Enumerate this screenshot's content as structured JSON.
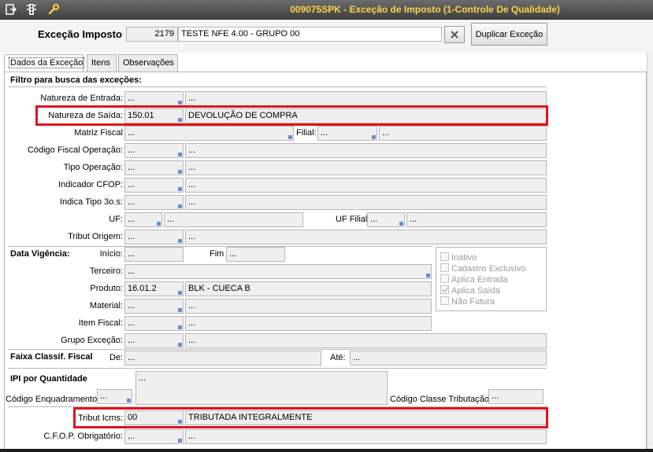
{
  "window": {
    "title": "009075SPK - Exceção de Imposto (1-Controle De Qualidade)"
  },
  "toolbar": {
    "icons": [
      "exit-icon",
      "traffic-light-icon",
      "wrench-icon"
    ]
  },
  "header": {
    "label": "Exceção Imposto",
    "code": "2179",
    "description": "TESTE NFE 4.00 - GRUPO 00",
    "duplicate_button": "Duplicar Exceção"
  },
  "tabs": [
    {
      "label": "Dados da Exceção"
    },
    {
      "label": "Itens"
    },
    {
      "label": "Observações"
    }
  ],
  "form": {
    "section_filter": "Filtro para busca das exceções:",
    "natureza_entrada": {
      "label": "Natureza de Entrada:",
      "code": "...",
      "desc": "..."
    },
    "natureza_saida": {
      "label": "Natureza de Saída:",
      "code": "150.01",
      "desc": "DEVOLUÇÃO DE COMPRA"
    },
    "matriz_fiscal": {
      "label": "Matriz Fiscal",
      "code": "...",
      "filial_label": "Filial:",
      "filial_code": "...",
      "filial_desc": "..."
    },
    "codigo_fiscal": {
      "label": "Código Fiscal Operação:",
      "code": "...",
      "desc": "..."
    },
    "tipo_operacao": {
      "label": "Tipo Operação:",
      "code": "...",
      "desc": "..."
    },
    "indicador_cfop": {
      "label": "Indicador CFOP:",
      "code": "...",
      "desc": "..."
    },
    "indica_tipo": {
      "label": "Indica Tipo 3o.s:",
      "code": "...",
      "desc": "..."
    },
    "uf": {
      "label": "UF:",
      "code": "...",
      "desc": "...",
      "filial_label": "UF Filial",
      "filial_code": "...",
      "filial_desc": "..."
    },
    "tribut_origem": {
      "label": "Tribut Origem:",
      "code": "...",
      "desc": "..."
    },
    "data_vigencia": {
      "label": "Data Vigência:",
      "inicio_label": "Início:",
      "inicio": "...",
      "fim_label": "Fim",
      "fim": "..."
    },
    "terceiro": {
      "label": "Terceiro:",
      "value": "..."
    },
    "produto": {
      "label": "Produto:",
      "code": "16.01.2",
      "desc": "BLK - CUECA B"
    },
    "material": {
      "label": "Material:",
      "code": "...",
      "desc": "..."
    },
    "item_fiscal": {
      "label": "Item Fiscal:",
      "code": "...",
      "desc": "..."
    },
    "grupo_excecao": {
      "label": "Grupo Exceção:",
      "code": "...",
      "desc": "..."
    },
    "faixa": {
      "label": "Faixa Classif. Fiscal",
      "de_label": "De:",
      "de": "...",
      "ate_label": "Até:",
      "ate": "..."
    },
    "ipi": {
      "label": "IPI por Quantidade",
      "memo": "...",
      "enquadramento_label": "Código Enquadramento",
      "enquadramento": "...",
      "classe_label": "Código Classe Tributação",
      "classe": "..."
    },
    "tribut_icms": {
      "label": "Tribut Icms:",
      "code": "00",
      "desc": "TRIBUTADA INTEGRALMENTE"
    },
    "cfop_obrigatorio": {
      "label": "C.F.O.P. Obrigatório:",
      "code": "...",
      "desc": "..."
    }
  },
  "checkboxes": [
    {
      "label": "Inativo",
      "checked": false
    },
    {
      "label": "Cadastro Exclusivo",
      "checked": false
    },
    {
      "label": "Aplica Entrada",
      "checked": false
    },
    {
      "label": "Aplica Saída",
      "checked": true
    },
    {
      "label": "Não Fatura",
      "checked": false
    }
  ],
  "colors": {
    "title_text": "#ffd24a",
    "highlight": "#e0141e",
    "lookup_dot": "#5c8fd6"
  }
}
